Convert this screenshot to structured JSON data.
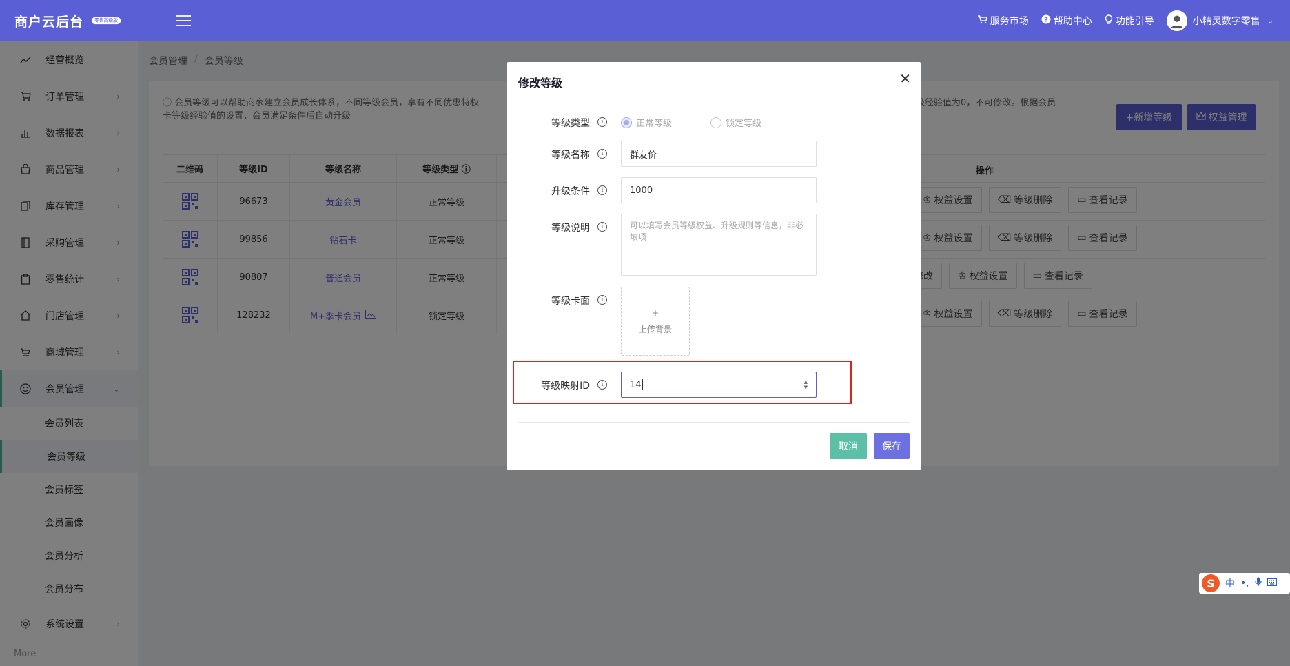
{
  "header": {
    "brand": "商户云后台",
    "brand_badge": "零售高级版",
    "links": [
      {
        "label": "服务市场",
        "icon": "cart-icon"
      },
      {
        "label": "帮助中心",
        "icon": "help-icon"
      },
      {
        "label": "功能引导",
        "icon": "bulb-icon"
      }
    ],
    "user_name": "小精灵数字零售"
  },
  "sidebar": {
    "items": [
      {
        "label": "经营概览",
        "icon": "trend-icon"
      },
      {
        "label": "订单管理",
        "icon": "cart-icon"
      },
      {
        "label": "数据报表",
        "icon": "bar-chart-icon"
      },
      {
        "label": "商品管理",
        "icon": "bag-icon"
      },
      {
        "label": "库存管理",
        "icon": "inventory-icon"
      },
      {
        "label": "采购管理",
        "icon": "notebook-icon"
      },
      {
        "label": "零售统计",
        "icon": "clipboard-icon"
      },
      {
        "label": "门店管理",
        "icon": "home-icon"
      },
      {
        "label": "商城管理",
        "icon": "shop-cart-icon"
      },
      {
        "label": "会员管理",
        "icon": "smile-icon"
      }
    ],
    "sub_items": [
      "会员列表",
      "会员等级",
      "会员标签",
      "会员画像",
      "会员分析",
      "会员分布"
    ],
    "settings": "系统设置",
    "more": "More"
  },
  "breadcrumb": [
    "会员管理",
    "会员等级"
  ],
  "notice": {
    "line1": "ⓘ 会员等级可以帮助商家建立会员成长体系，不同等级会员，享有不同优惠特权",
    "line1_tail": "等级经验值为0，不可修改。根据会员",
    "line2": "卡等级经验值的设置，会员满足条件后自动升级"
  },
  "buttons": {
    "add_level": "+新增等级",
    "rights": "权益管理"
  },
  "table": {
    "headers": [
      "二维码",
      "等级ID",
      "等级名称",
      "等级类型 ⓘ",
      "操作"
    ],
    "rows": [
      {
        "id": "96673",
        "name": "黄金会员",
        "type": "正常等级"
      },
      {
        "id": "99856",
        "name": "钻石卡",
        "type": "正常等级"
      },
      {
        "id": "90807",
        "name": "普通会员",
        "type": "正常等级"
      },
      {
        "id": "128232",
        "name": "M+季卡会员",
        "type": "锁定等级"
      }
    ],
    "op_labels": {
      "edit": "修改",
      "rights": "权益设置",
      "delete": "等级删除",
      "log": "查看记录"
    }
  },
  "modal": {
    "title": "修改等级",
    "fields": {
      "type_label": "等级类型",
      "type_options": [
        "正常等级",
        "锁定等级"
      ],
      "name_label": "等级名称",
      "name_value": "群友价",
      "upgrade_label": "升级条件",
      "upgrade_value": "1000",
      "desc_label": "等级说明",
      "desc_placeholder": "可以填写会员等级权益、升级规则等信息，非必填项",
      "card_label": "等级卡面",
      "upload_plus": "+",
      "upload_label": "上传背景",
      "map_label": "等级映射ID",
      "map_value": "14"
    },
    "cancel": "取消",
    "save": "保存"
  },
  "ime": {
    "lang": "中"
  }
}
